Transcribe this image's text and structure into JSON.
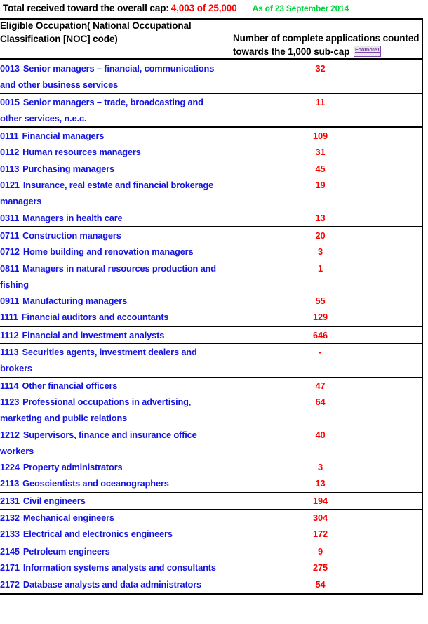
{
  "banner": {
    "label": "Total received toward the overall cap:",
    "total": "4,003 of 25,000",
    "as_of": "As of 23 September  2014",
    "label_color": "#000000",
    "total_color": "#ff0000",
    "as_of_color": "#00d43c"
  },
  "table": {
    "headers": {
      "occupation": "Eligible Occupation( National Occupational Classification [NOC] code)",
      "count_prefix": "Number of complete applications counted towards the 1,000 sub-cap",
      "footnote_label": "Footnote1"
    },
    "colors": {
      "occupation_text": "#1414e0",
      "count_text": "#ff0000",
      "border": "#000000",
      "footnote": "#7b44a8"
    },
    "rows": [
      {
        "code": "0013",
        "title": "Senior managers – financial, communications and other business services",
        "count": "32",
        "sep": "thin"
      },
      {
        "code": "0015",
        "title": "Senior managers – trade, broadcasting and other services, n.e.c.",
        "count": "11",
        "sep": "thick"
      },
      {
        "code": "0111",
        "title": "Financial managers",
        "count": "109",
        "sep": "none"
      },
      {
        "code": "0112",
        "title": "Human resources managers",
        "count": "31",
        "sep": "none"
      },
      {
        "code": "0113",
        "title": "Purchasing managers",
        "count": "45",
        "sep": "none"
      },
      {
        "code": "0121",
        "title": "Insurance, real estate and financial brokerage managers",
        "count": "19",
        "sep": "none"
      },
      {
        "code": "0311",
        "title": "Managers in health care",
        "count": "13",
        "sep": "thick"
      },
      {
        "code": "0711",
        "title": "Construction managers",
        "count": "20",
        "sep": "none"
      },
      {
        "code": "0712",
        "title": "Home building and renovation managers",
        "count": "3",
        "sep": "none"
      },
      {
        "code": "0811",
        "title": "Managers in natural resources production and fishing",
        "count": "1",
        "sep": "none"
      },
      {
        "code": "0911",
        "title": "Manufacturing managers",
        "count": "55",
        "sep": "none"
      },
      {
        "code": "1111",
        "title": "Financial auditors and accountants",
        "count": "129",
        "sep": "thick"
      },
      {
        "code": "1112",
        "title": "Financial and investment analysts",
        "count": "646",
        "sep": "thin"
      },
      {
        "code": "1113",
        "title": "Securities agents, investment dealers and brokers",
        "count": "-",
        "sep": "thin"
      },
      {
        "code": "1114",
        "title": "Other financial officers",
        "count": "47",
        "sep": "none"
      },
      {
        "code": "1123",
        "title": "Professional occupations in advertising, marketing and public relations",
        "count": "64",
        "sep": "none"
      },
      {
        "code": "1212",
        "title": "Supervisors, finance and insurance office workers",
        "count": "40",
        "sep": "none"
      },
      {
        "code": "1224",
        "title": "Property administrators",
        "count": "3",
        "sep": "none"
      },
      {
        "code": "2113",
        "title": "Geoscientists and oceanographers",
        "count": "13",
        "sep": "thin"
      },
      {
        "code": "2131",
        "title": "Civil engineers",
        "count": "194",
        "sep": "thin"
      },
      {
        "code": "2132",
        "title": "Mechanical engineers",
        "count": "304",
        "sep": "none"
      },
      {
        "code": "2133",
        "title": "Electrical and electronics engineers",
        "count": "172",
        "sep": "thin"
      },
      {
        "code": "2145",
        "title": "Petroleum engineers",
        "count": "9",
        "sep": "none"
      },
      {
        "code": "2171",
        "title": "Information systems analysts and consultants",
        "count": "275",
        "sep": "thin"
      },
      {
        "code": "2172",
        "title": "Database analysts and data administrators",
        "count": "54",
        "sep": "none"
      }
    ]
  }
}
